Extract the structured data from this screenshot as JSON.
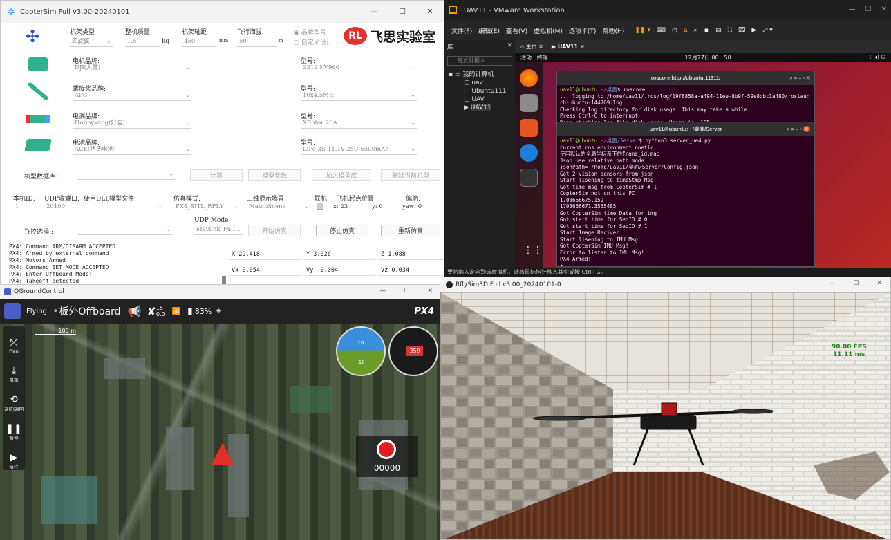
{
  "coptersim": {
    "title": "CopterSim Full v3.00-20240101",
    "brand": "飞思实验室",
    "frame": {
      "type_label": "机架类型",
      "type_value": "四旋翼",
      "mass_label": "整机质量",
      "mass_value": "1.5",
      "mass_unit": "kg",
      "axle_label": "机架轴距",
      "axle_value": "450",
      "axle_unit": "mm",
      "alt_label": "飞行海拔",
      "alt_value": "50",
      "alt_unit": "m",
      "opt_brand": "品牌型号",
      "opt_custom": "自定义设计"
    },
    "motor": {
      "brand_label": "电机品牌:",
      "brand_value": "DJI(大疆)",
      "model_label": "型号:",
      "model_value": "2312 KV960"
    },
    "prop": {
      "brand_label": "螺旋桨品牌:",
      "brand_value": "APC",
      "model_label": "型号:",
      "model_value": "10x4.5MR"
    },
    "esc": {
      "brand_label": "电调品牌:",
      "brand_value": "Hobbywing(好盈)",
      "model_label": "型号:",
      "model_value": "XRotor 20A"
    },
    "battery": {
      "brand_label": "电池品牌:",
      "brand_value": "ACE(格氏电池)",
      "model_label": "型号:",
      "model_value": "LiPo 3S-11.1V-25C-5500mAh"
    },
    "db": {
      "label": "机型数据库:",
      "compute": "计算",
      "params": "模型参数",
      "add": "加入模型库",
      "delete": "删除当前机型"
    },
    "sim": {
      "id_label": "本机ID:",
      "id_value": "1",
      "udp_label": "UDP收端口:",
      "udp_value": "20100",
      "dll_label": "使用DLL模型文件:",
      "mode_label": "仿真模式:",
      "mode_value": "PX4_SITL_RFLY",
      "scene_label": "三维显示场景:",
      "scene_value": "MatchScene",
      "link_label": "联机",
      "start_label": "飞机起点位置:",
      "x_label": "x: 23",
      "y_label": "y: 0",
      "yaw_top": "偏航:",
      "yaw_label": "yaw: 0"
    },
    "ctrl": {
      "label": "飞控选择 :",
      "udp_mode_label": "UDP Mode",
      "udp_mode_value": "Mavlink_Full",
      "start": "开始仿真",
      "stop": "停止仿真",
      "restart": "重新仿真"
    },
    "log": [
      "PX4: Command ARM/DISARM ACCEPTED",
      "PX4: Armed by external command",
      "PX4: Motors Armed",
      "PX4: Command SET_MODE ACCEPTED",
      "PX4: Enter Offboard Mode!",
      "PX4: Takeoff detected"
    ],
    "pos": {
      "x": "X 29.418",
      "y": "Y 3.026",
      "z": "Z 1.088",
      "vx": "Vx 0.054",
      "vy": "Vy -0.004",
      "vz": "Vz 0.034"
    }
  },
  "vmware": {
    "title": "UAV11 - VMware Workstation",
    "menu": [
      "文件(F)",
      "编辑(E)",
      "查看(V)",
      "虚拟机(M)",
      "选项卡(T)",
      "帮助(H)"
    ],
    "library_label": "库",
    "search_placeholder": "在此处键入...",
    "tree": [
      "我的计算机",
      "uav",
      "Ubuntu111",
      "UAV",
      "UAV11"
    ],
    "tab_home": "主页",
    "tab_vm": "UAV11",
    "activities": "活动",
    "terminal_label": "终端",
    "clock": "12月27日 00 : 50",
    "status": "要将输入定向到该虚拟机，请将鼠标指针移入其中或按 Ctrl+G。"
  },
  "term1": {
    "title": "roscore http://ubuntu:11311/",
    "user": "uav11@ubuntu",
    "path": ":~/桌面",
    "cmd": "$ roscore",
    "lines": [
      "... logging to /home/uav11/.ros/log/19f8858a-a494-11ee-8b9f-59e8dbc1a480/roslaun",
      "ch-ubuntu-144769.log",
      "Checking log directory for disk usage. This may take a while.",
      "Press Ctrl-C to interrupt",
      "Done checking log file disk usage. Usage is <1GB."
    ]
  },
  "term2": {
    "title": "uav11@ubuntu: ~/桌面/Server",
    "user": "uav11@ubuntu",
    "path": ":~/桌面/Server",
    "cmd": "$ python3 server_ue4.py",
    "lines": [
      "current ros environment noetic",
      "使用默认的全局坐标系下的frame_id:map",
      "Json use relative path mode",
      "jsonPath= /home/uav11/桌面/Server/Config.json",
      "Got 2 vision sensors from json",
      "Start lisening to timeStmp Msg",
      "Got time msg from CopterSim # 1",
      "CopterSim not on this PC",
      "1703666675.152",
      "1703666671.3565485",
      "Got CopterSim time Data for img",
      "Got start time for SeqID # 0",
      "Got start time for SeqID # 1",
      "Start Image Reciver",
      "Start lisening to IMU Msg",
      "Got CopterSim IMU Msg!",
      "Error to listen to IMU Msg!",
      "PX4 Armed!"
    ]
  },
  "qgc": {
    "title": "QGroundControl",
    "flying": "Flying",
    "mode": "板外Offboard",
    "sats": "15",
    "hdop": "0.0",
    "battery": "83%",
    "scale": "100 m",
    "logo": "PX4",
    "tools": [
      "Plan",
      "降落",
      "返航|返回",
      "暂停",
      "执行"
    ],
    "heading": "359",
    "counter": "00000",
    "pitch_up": "10",
    "pitch_down": "-10"
  },
  "rflysim": {
    "title": "RflySim3D Full v3.00_20240101-0",
    "fps": "90.00 FPS",
    "ms": "11.11 ms"
  }
}
